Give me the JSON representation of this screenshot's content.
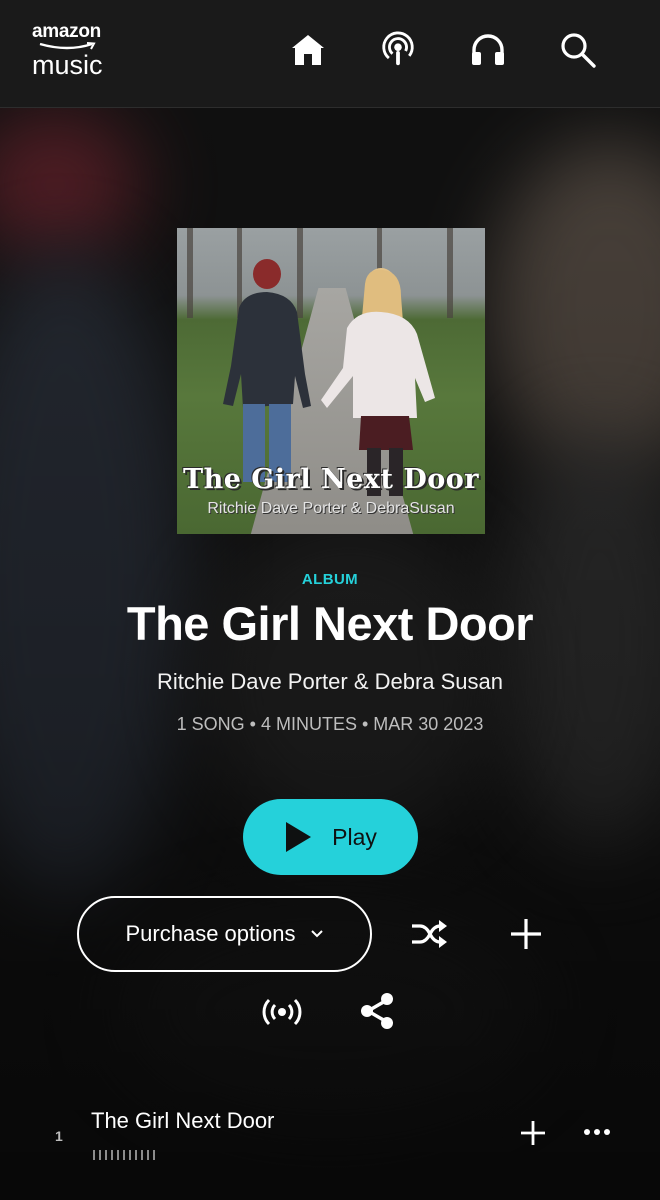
{
  "brand": {
    "line1": "amazon",
    "line2": "music"
  },
  "nav": [
    {
      "id": "home",
      "icon": "home-icon"
    },
    {
      "id": "podcasts",
      "icon": "podcast-icon"
    },
    {
      "id": "library",
      "icon": "headphones-icon"
    },
    {
      "id": "search",
      "icon": "search-icon"
    }
  ],
  "cover": {
    "title": "The Girl Next Door",
    "subtitle": "Ritchie Dave Porter & DebraSusan"
  },
  "album": {
    "label": "ALBUM",
    "title": "The Girl Next Door",
    "artist": "Ritchie Dave Porter & Debra Susan",
    "meta": "1 SONG • 4 MINUTES • MAR 30 2023"
  },
  "actions": {
    "play_label": "Play",
    "purchase_label": "Purchase options"
  },
  "tracks": [
    {
      "number": "1",
      "title": "The Girl Next Door"
    }
  ],
  "colors": {
    "accent": "#25d1da",
    "background": "#141414",
    "topbar": "#1a1a1a"
  }
}
